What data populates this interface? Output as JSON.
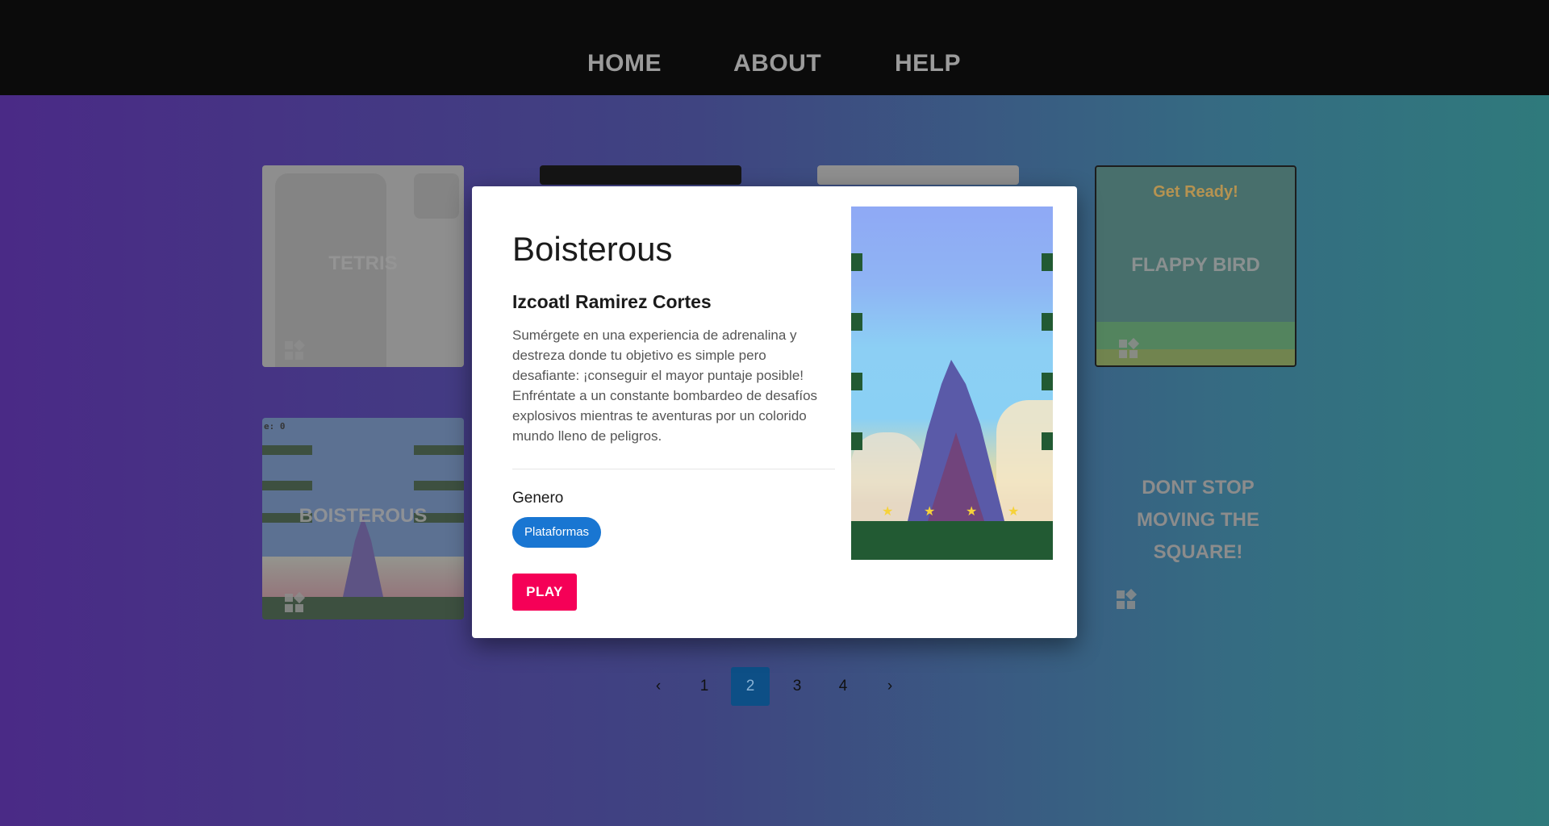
{
  "nav": {
    "items": [
      {
        "label": "HOME"
      },
      {
        "label": "ABOUT"
      },
      {
        "label": "HELP"
      }
    ]
  },
  "cards": {
    "tetris": {
      "title": "TETRIS"
    },
    "flappy": {
      "title": "FLAPPY BIRD",
      "ready_text": "Get Ready!"
    },
    "boisterous": {
      "title": "BOISTEROUS",
      "score": "e: 0"
    },
    "dontstop": {
      "line1": "DONT STOP",
      "line2": "MOVING THE",
      "line3": "SQUARE!"
    }
  },
  "modal": {
    "title": "Boisterous",
    "author": "Izcoatl Ramirez Cortes",
    "description": "Sumérgete en una experiencia de adrenalina y destreza donde tu objetivo es simple pero desafiante: ¡conseguir el mayor puntaje posible! Enfréntate a un constante bombardeo de desafíos explosivos mientras te aventuras por un colorido mundo lleno de peligros.",
    "genre_label": "Genero",
    "genre_chip": "Plataformas",
    "play_label": "PLAY"
  },
  "pagination": {
    "prev": "‹",
    "pages": [
      "1",
      "2",
      "3",
      "4"
    ],
    "active_page": "2",
    "next": "›"
  },
  "colors": {
    "accent_play": "#f50057",
    "chip": "#1976d2",
    "active_page": "#0d4f86"
  }
}
